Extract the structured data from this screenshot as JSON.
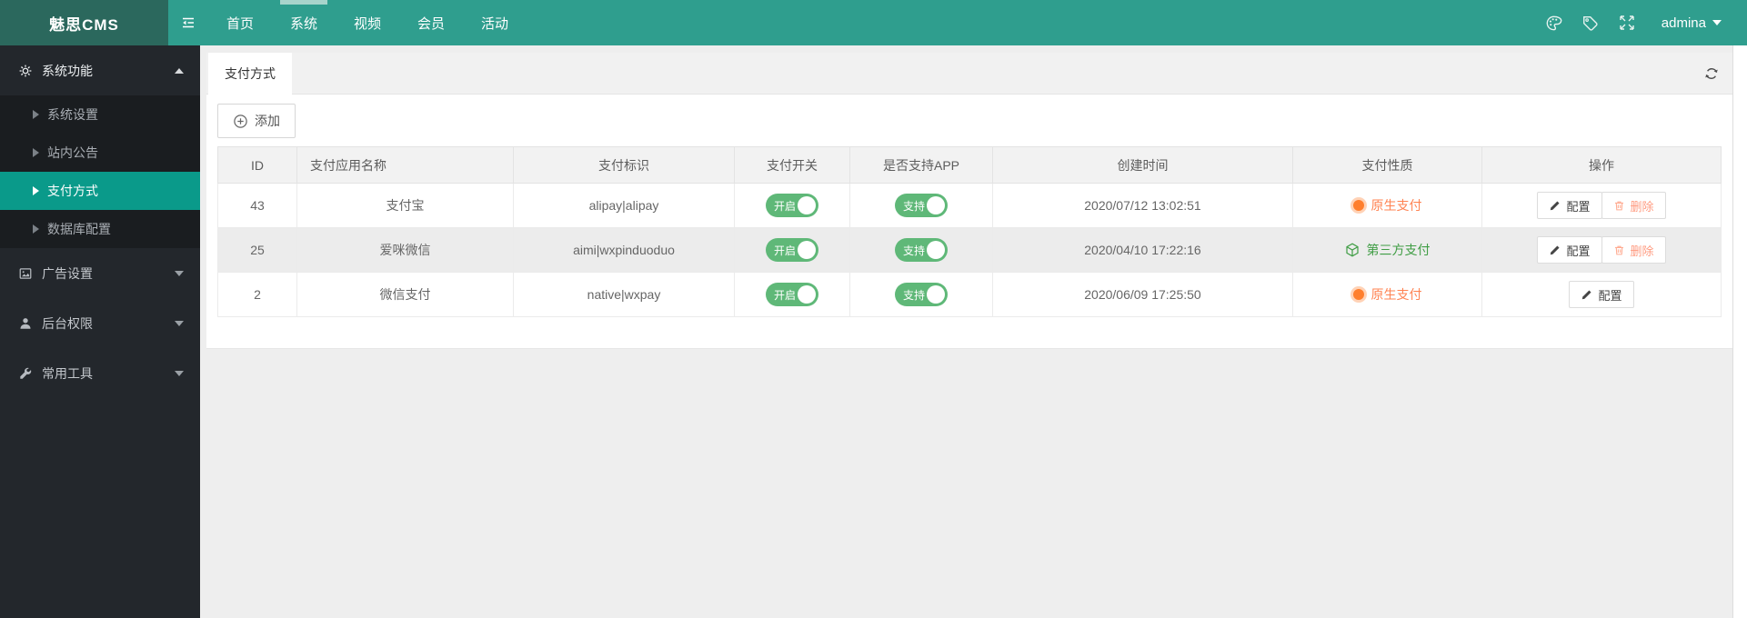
{
  "topbar": {
    "logo": "魅思CMS",
    "nav": [
      {
        "label": "首页",
        "active": false
      },
      {
        "label": "系统",
        "active": true
      },
      {
        "label": "视频",
        "active": false
      },
      {
        "label": "会员",
        "active": false
      },
      {
        "label": "活动",
        "active": false
      }
    ],
    "user": "admina"
  },
  "sidebar": {
    "groups": [
      {
        "label": "系统功能",
        "expanded": true,
        "children": [
          "系统设置",
          "站内公告",
          "支付方式",
          "数据库配置"
        ]
      },
      {
        "label": "广告设置",
        "expanded": false
      },
      {
        "label": "后台权限",
        "expanded": false
      },
      {
        "label": "常用工具",
        "expanded": false
      }
    ],
    "active_child": "支付方式"
  },
  "tabs": {
    "active": "支付方式"
  },
  "toolbar": {
    "add_label": "添加"
  },
  "table": {
    "headers": [
      "ID",
      "支付应用名称",
      "支付标识",
      "支付开关",
      "是否支持APP",
      "创建时间",
      "支付性质",
      "操作"
    ],
    "rows": [
      {
        "id": "43",
        "name": "支付宝",
        "identifier": "alipay|alipay",
        "switch": "开启",
        "app": "支持",
        "created": "2020/07/12 13:02:51",
        "nature": "原生支付",
        "nature_type": "native",
        "actions": [
          "配置",
          "删除"
        ]
      },
      {
        "id": "25",
        "name": "爱咪微信",
        "identifier": "aimi|wxpinduoduo",
        "switch": "开启",
        "app": "支持",
        "created": "2020/04/10 17:22:16",
        "nature": "第三方支付",
        "nature_type": "third-party",
        "actions": [
          "配置",
          "删除"
        ]
      },
      {
        "id": "2",
        "name": "微信支付",
        "identifier": "native|wxpay",
        "switch": "开启",
        "app": "支持",
        "created": "2020/06/09 17:25:50",
        "nature": "原生支付",
        "nature_type": "native",
        "actions": [
          "配置"
        ]
      }
    ]
  },
  "colors": {
    "topbar_teal": "#2F9E8E",
    "logo_bg": "#2B685D",
    "nav_active_indicator": "#A7D4CB",
    "sidebar_bg": "#23272C",
    "sidebar_active": "#0A9A8A",
    "toggle_on": "#5FB878",
    "native_orange": "#FF7F2E",
    "third_party_green": "#3F9D44",
    "delete_salmon": "#FF9B80"
  },
  "icons": {
    "hamburger": "menu-collapse-lines",
    "palette": "theme-palette",
    "tag": "label-tag",
    "fullscreen": "expand-arrows",
    "refresh": "circular-arrows",
    "gear": "settings-gear",
    "ad": "image-frame",
    "permission": "person",
    "tools": "wrench",
    "add": "circle-plus",
    "configure": "pencil",
    "delete": "trash"
  }
}
